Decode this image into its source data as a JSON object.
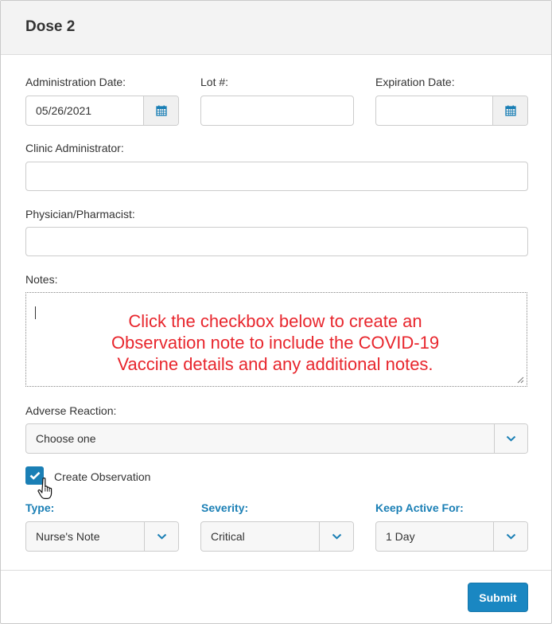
{
  "header": {
    "title": "Dose 2"
  },
  "form": {
    "administration_date": {
      "label": "Administration Date:",
      "value": "05/26/2021"
    },
    "lot": {
      "label": "Lot #:",
      "value": ""
    },
    "expiration_date": {
      "label": "Expiration Date:",
      "value": ""
    },
    "clinic_administrator": {
      "label": "Clinic Administrator:",
      "value": ""
    },
    "physician_pharmacist": {
      "label": "Physician/Pharmacist:",
      "value": ""
    },
    "notes": {
      "label": "Notes:",
      "value": ""
    },
    "adverse_reaction": {
      "label": "Adverse Reaction:",
      "selected": "Choose one"
    },
    "create_observation": {
      "label": "Create Observation",
      "checked": true
    },
    "type": {
      "label": "Type:",
      "selected": "Nurse's Note"
    },
    "severity": {
      "label": "Severity:",
      "selected": "Critical"
    },
    "keep_active": {
      "label": "Keep Active For:",
      "selected": "1 Day"
    }
  },
  "annotation": {
    "line1": "Click the checkbox below to create an",
    "line2": "Observation note to include the COVID-19",
    "line3": "Vaccine details and any additional notes."
  },
  "footer": {
    "submit_label": "Submit"
  },
  "icons": {
    "calendar": "calendar-icon",
    "dropdown": "chevron-down-icon",
    "check": "checkmark-icon",
    "cursor": "hand-pointer-icon"
  },
  "colors": {
    "accent": "#1a7fb5",
    "annotation": "#e8262d",
    "submit": "#1a87c2"
  }
}
